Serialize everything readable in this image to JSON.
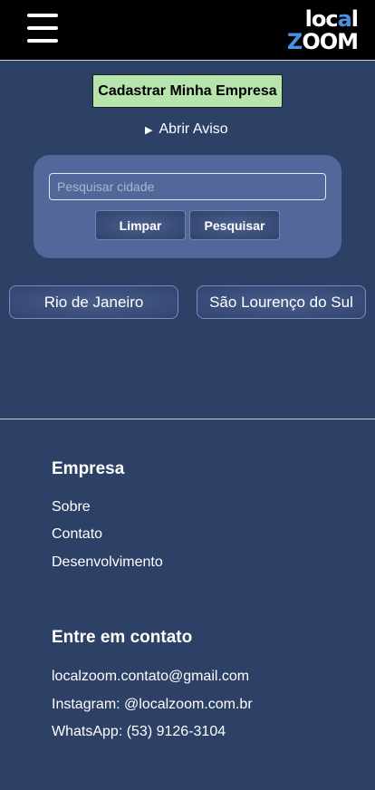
{
  "header": {
    "menu_icon": "hamburger-menu-icon",
    "logo_line1_a": "loc",
    "logo_line1_b": "a",
    "logo_line1_c": "l",
    "logo_line2_a": "Z",
    "logo_line2_b": "OOM",
    "logo_colors": {
      "text": "#ffffff",
      "accent": "#4a90e2"
    }
  },
  "actions": {
    "register_label": "Cadastrar Minha Empresa",
    "notice_label": "Abrir Aviso",
    "notice_icon": "disclosure-triangle-icon"
  },
  "search": {
    "placeholder": "Pesquisar cidade",
    "value": "",
    "clear_label": "Limpar",
    "search_label": "Pesquisar"
  },
  "cities": [
    "Rio de Janeiro",
    "São Lourenço do Sul"
  ],
  "footer": {
    "company": {
      "heading": "Empresa",
      "links": [
        "Sobre",
        "Contato",
        "Desenvolvimento"
      ]
    },
    "contact": {
      "heading": "Entre em contato",
      "items": [
        "localzoom.contato@gmail.com",
        "Instagram: @localzoom.com.br",
        "WhatsApp: (53) 9126-3104"
      ]
    }
  },
  "colors": {
    "page_bg": "#2d4065",
    "header_bg": "#000000",
    "register_button_bg": "#b7e4ad",
    "search_panel_bg": "#52679a"
  }
}
